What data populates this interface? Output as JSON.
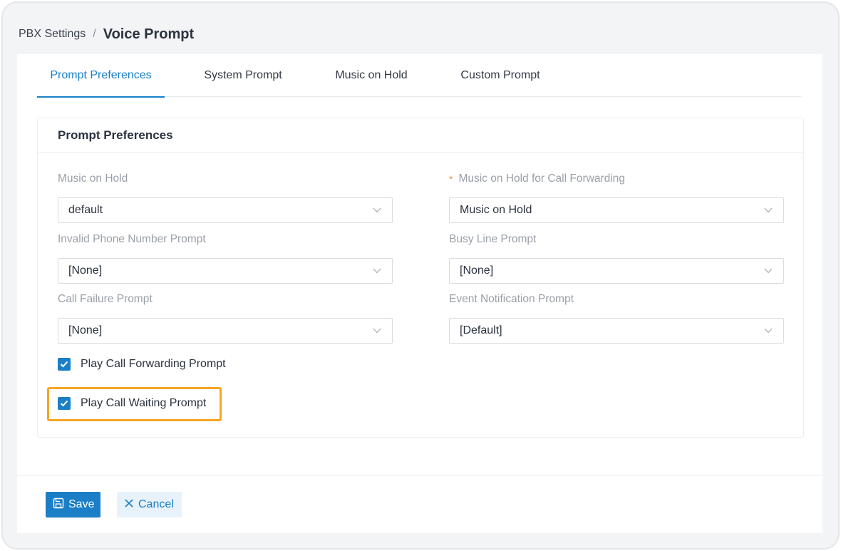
{
  "breadcrumb": {
    "parent": "PBX Settings",
    "separator": "/",
    "current": "Voice Prompt"
  },
  "tabs": [
    {
      "label": "Prompt Preferences",
      "active": true
    },
    {
      "label": "System Prompt",
      "active": false
    },
    {
      "label": "Music on Hold",
      "active": false
    },
    {
      "label": "Custom Prompt",
      "active": false
    }
  ],
  "card": {
    "title": "Prompt Preferences",
    "fields": [
      {
        "label": "Music on Hold",
        "value": "default",
        "required": false
      },
      {
        "label": "Music on Hold for Call Forwarding",
        "value": "Music on Hold",
        "required": true,
        "required_mark": "*"
      },
      {
        "label": "Invalid Phone Number Prompt",
        "value": "[None]",
        "required": false
      },
      {
        "label": "Busy Line Prompt",
        "value": "[None]",
        "required": false
      },
      {
        "label": "Call Failure Prompt",
        "value": "[None]",
        "required": false
      },
      {
        "label": "Event Notification Prompt",
        "value": "[Default]",
        "required": false
      }
    ],
    "checkboxes": [
      {
        "label": "Play Call Forwarding Prompt",
        "checked": true
      },
      {
        "label": "Play Call Waiting Prompt",
        "checked": true,
        "highlighted": true
      }
    ]
  },
  "footer": {
    "save_label": "Save",
    "cancel_label": "Cancel",
    "save_icon": "save-icon",
    "cancel_icon": "close-icon"
  },
  "colors": {
    "accent": "#1a7fc6",
    "highlight": "#f5a623",
    "required": "#f08c3a"
  }
}
